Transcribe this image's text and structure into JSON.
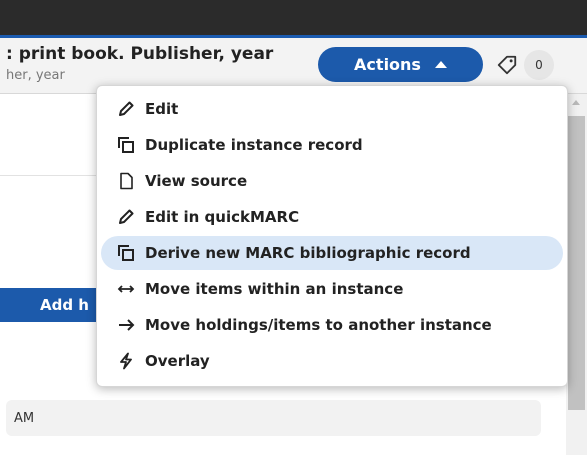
{
  "header": {
    "title": ": print book. Publisher, year",
    "subtitle": "her, year",
    "actions_label": "Actions",
    "tag_count": "0"
  },
  "content": {
    "add_button_label": "Add h",
    "field_value": "AM"
  },
  "actions_menu": {
    "items": [
      {
        "label": "Edit",
        "icon": "pencil-icon"
      },
      {
        "label": "Duplicate instance record",
        "icon": "duplicate-icon"
      },
      {
        "label": "View source",
        "icon": "document-icon"
      },
      {
        "label": "Edit in quickMARC",
        "icon": "pencil-icon"
      },
      {
        "label": "Derive new MARC bibliographic record",
        "icon": "duplicate-icon",
        "highlighted": true
      },
      {
        "label": "Move items within an instance",
        "icon": "left-right-arrow-icon"
      },
      {
        "label": "Move holdings/items to another instance",
        "icon": "right-arrow-icon"
      },
      {
        "label": "Overlay",
        "icon": "lightning-icon"
      }
    ]
  },
  "colors": {
    "accent": "#1c5aab",
    "topbar": "#2b2b2b",
    "highlight": "#d9e7f7"
  }
}
